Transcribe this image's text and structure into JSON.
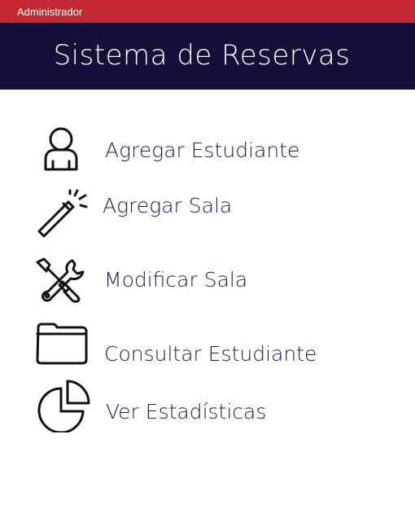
{
  "topbar": {
    "user_label": "Administrador"
  },
  "header": {
    "title": "Sistema de Reservas"
  },
  "menu": {
    "items": [
      {
        "label": "Agregar Estudiante",
        "icon": "user-icon"
      },
      {
        "label": "Agregar Sala",
        "icon": "magic-wand-icon"
      },
      {
        "label": "Modificar Sala",
        "icon": "tools-icon"
      },
      {
        "label": "Consultar Estudiante",
        "icon": "folder-icon"
      },
      {
        "label": "Ver Estadísticas",
        "icon": "pie-chart-icon"
      }
    ]
  },
  "colors": {
    "topbar": "#c62832",
    "header": "#15103a",
    "text": "#1a1f4a"
  }
}
